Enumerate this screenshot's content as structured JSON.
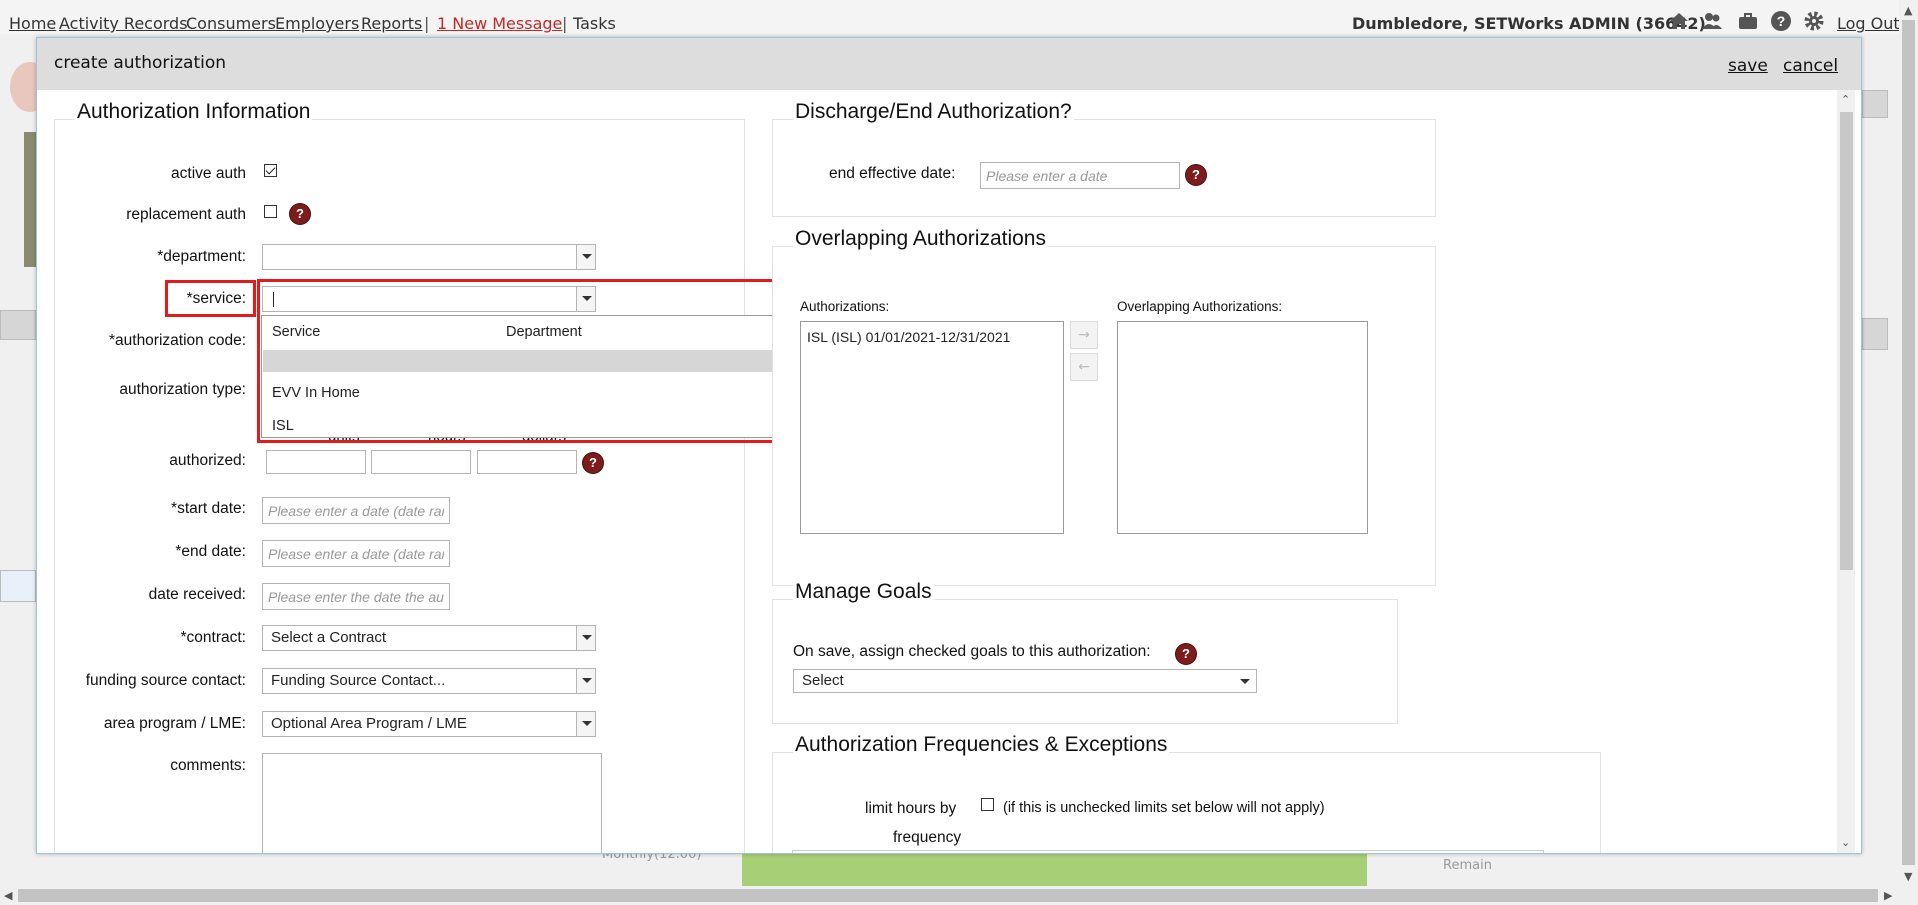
{
  "nav": {
    "links": [
      "Home",
      "Activity Records",
      "Consumers",
      "Employers",
      "Reports"
    ],
    "separator": "|",
    "new_message": "1 New Message",
    "tasks": "Tasks",
    "user": "Dumbledore, SETWorks ADMIN  (36642)",
    "logout": "Log Out",
    "icons": [
      "home-icon",
      "users-icon",
      "briefcase-icon",
      "help-icon",
      "gear-icon"
    ]
  },
  "background": {
    "remain_label": "Remain",
    "monthly_label": "Monthly(12.00)"
  },
  "dialog": {
    "title": "create authorization",
    "save": "save",
    "cancel": "cancel"
  },
  "auth_info": {
    "title": "Authorization Information",
    "active_auth_label": "active auth",
    "active_auth_checked": true,
    "replacement_auth_label": "replacement auth",
    "replacement_auth_checked": false,
    "department_label": "*department:",
    "department_value": "",
    "service_label": "*service:",
    "service_value": "",
    "auth_code_label": "*authorization code:",
    "auth_type_label": "authorization type:",
    "units_label": "units",
    "hours_label": "hours",
    "dollars_label": "dollars",
    "authorized_label": "authorized:",
    "start_date_label": "*start date:",
    "start_date_placeholder": "Please enter a date (date range)",
    "end_date_label": "*end date:",
    "end_date_placeholder": "Please enter a date (date range)",
    "date_received_label": "date received:",
    "date_received_placeholder": "Please enter the date the auth was received",
    "contract_label": "*contract:",
    "contract_value": "Select a Contract",
    "funding_label": "funding source contact:",
    "funding_value": "Funding Source Contact...",
    "area_label": "area program / LME:",
    "area_value": "Optional Area Program / LME",
    "comments_label": "comments:",
    "help_glyph": "?"
  },
  "service_dropdown": {
    "col_service": "Service",
    "col_department": "Department",
    "options": [
      "",
      "EVV In Home",
      "ISL"
    ]
  },
  "discharge": {
    "title": "Discharge/End Authorization?",
    "end_date_label": "end effective date:",
    "end_date_placeholder": "Please enter a date"
  },
  "overlapping": {
    "title": "Overlapping Authorizations",
    "auths_label": "Authorizations:",
    "auths_items": [
      "ISL (ISL) 01/01/2021-12/31/2021"
    ],
    "overlap_label": "Overlapping Authorizations:",
    "move_right": "→",
    "move_left": "←"
  },
  "goals": {
    "title": "Manage Goals",
    "assign_label": "On save, assign checked goals to this authorization:",
    "select_value": "Select"
  },
  "frequencies": {
    "title": "Authorization Frequencies & Exceptions",
    "limit_label": "limit hours by",
    "limit_label_2": "frequency",
    "limit_note": "(if this is unchecked limits set below will not apply)"
  }
}
